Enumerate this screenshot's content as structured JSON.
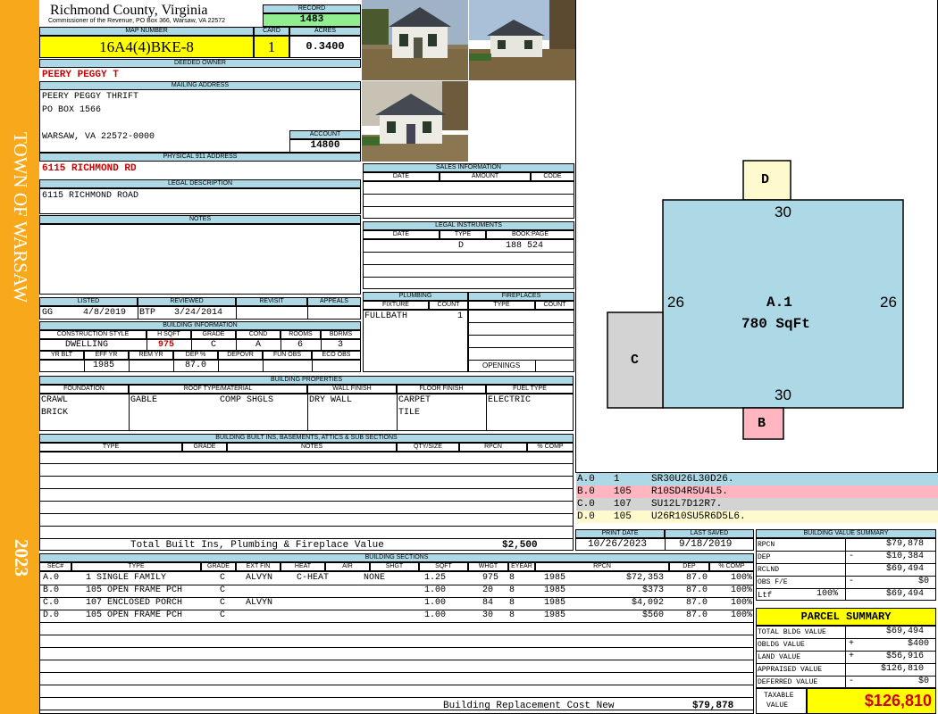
{
  "sidebar": {
    "town": "TOWN OF WARSAW",
    "year": "2023"
  },
  "header": {
    "county": "Richmond County, Virginia",
    "address": "Commissioner of the Revenue, PO Box 366, Warsaw, VA 22572",
    "record_label": "RECORD",
    "record": "1483",
    "map_label": "MAP NUMBER",
    "map_number": "16A4(4)BKE-8",
    "card_label": "CARD",
    "card": "1",
    "acres_label": "ACRES",
    "acres": "0.3400"
  },
  "owner": {
    "deeded_label": "DEEDED OWNER",
    "deeded": "PEERY PEGGY T",
    "mailing_label": "MAILING ADDRESS",
    "mail1": "PEERY PEGGY THRIFT",
    "mail2": "PO BOX 1566",
    "mail3": "WARSAW, VA 22572-0000",
    "account_label": "ACCOUNT",
    "account": "14800",
    "p911_label": "PHYSICAL 911 ADDRESS",
    "p911": "6115 RICHMOND RD",
    "legal_label": "LEGAL DESCRIPTION",
    "legal": "6115 RICHMOND ROAD",
    "notes_label": "NOTES"
  },
  "sales": {
    "title": "SALES INFORMATION",
    "cols": [
      "DATE",
      "AMOUNT",
      "CODE"
    ]
  },
  "legal_instruments": {
    "title": "LEGAL INSTRUMENTS",
    "cols": [
      "DATE",
      "TYPE",
      "BOOK:PAGE"
    ],
    "type": "D",
    "bookpage": "188 524"
  },
  "listing": {
    "cols": [
      "LISTED",
      "REVIEWED",
      "REVISIT",
      "APPEALS"
    ],
    "listed_by": "GG",
    "listed": "4/8/2019",
    "reviewed_by": "BTP",
    "reviewed": "3/24/2014"
  },
  "plumbing": {
    "title": "PLUMBING",
    "cols": [
      "FIXTURE",
      "COUNT"
    ],
    "fixture": "FULLBATH",
    "count": "1"
  },
  "fireplaces": {
    "title": "FIREPLACES",
    "cols": [
      "TYPE",
      "COUNT"
    ],
    "openings": "OPENINGS"
  },
  "building_info": {
    "title": "BUILDING INFORMATION",
    "cols1": [
      "CONSTRUCTION STYLE",
      "H SQFT",
      "GRADE",
      "COND",
      "ROOMS",
      "BDRMS"
    ],
    "style": "DWELLING",
    "hsqft": "975",
    "grade": "C",
    "cond": "A",
    "rooms": "6",
    "bdrms": "3",
    "cols2": [
      "YR BLT",
      "EFF YR",
      "REM YR",
      "DEP %",
      "DEPOVR",
      "FUN OBS",
      "ECO OBS"
    ],
    "eff_yr": "1985",
    "dep": "87.0"
  },
  "properties": {
    "title": "BUILDING PROPERTIES",
    "cols": [
      "FOUNDATION",
      "ROOF TYPE/MATERIAL",
      "WALL FINISH",
      "FLOOR FINISH",
      "FUEL TYPE"
    ],
    "foundation1": "CRAWL",
    "foundation2": "BRICK",
    "roof_type": "GABLE",
    "roof_mat": "COMP SHGLS",
    "wall": "DRY WALL",
    "floor1": "CARPET",
    "floor2": "TILE",
    "fuel": "ELECTRIC"
  },
  "builtins": {
    "title": "BUILDING BUILT INS, BASEMENTS, ATTICS & SUB SECTIONS",
    "cols": [
      "TYPE",
      "GRADE",
      "NOTES",
      "QTY/SIZE",
      "RPCN",
      "% COMP"
    ],
    "total_label": "Total Built Ins, Plumbing & Fireplace Value",
    "total": "$2,500"
  },
  "print": {
    "cols": [
      "PRINT DATE",
      "LAST SAVED"
    ],
    "print_date": "10/26/2023",
    "last_saved": "9/18/2019"
  },
  "sections": {
    "title": "BUILDING SECTIONS",
    "cols": [
      "SEC#",
      "TYPE",
      "GRADE",
      "EXT FIN",
      "HEAT",
      "AIR",
      "SHGT",
      "SQFT",
      "WHGT",
      "EYEAR",
      "RPCN",
      "DEP",
      "% COMP"
    ],
    "rows": [
      [
        "A.0",
        "1 SINGLE FAMILY",
        "C",
        "ALVYN",
        "C-HEAT",
        "NONE",
        "1.25",
        "975",
        "8",
        "1985",
        "$72,353",
        "87.0",
        "100%"
      ],
      [
        "B.0",
        "105 OPEN FRAME PCH",
        "C",
        "",
        "",
        "",
        "1.00",
        "20",
        "8",
        "1985",
        "$373",
        "87.0",
        "100%"
      ],
      [
        "C.0",
        "107 ENCLOSED PORCH",
        "C",
        "ALVYN",
        "",
        "",
        "1.00",
        "84",
        "8",
        "1985",
        "$4,092",
        "87.0",
        "100%"
      ],
      [
        "D.0",
        "105 OPEN FRAME PCH",
        "C",
        "",
        "",
        "",
        "1.00",
        "30",
        "8",
        "1985",
        "$560",
        "87.0",
        "100%"
      ]
    ],
    "brcn_label": "Building Replacement Cost New",
    "brcn": "$79,878"
  },
  "sketch": {
    "main_label": "A.1",
    "main_area": "780 SqFt",
    "dim_top": "30",
    "dim_bottom": "30",
    "dim_left": "26",
    "dim_right": "26",
    "d_label": "D",
    "c_label": "C",
    "b_label": "B"
  },
  "legend": [
    {
      "sec": "A.0",
      "code": "1",
      "path": "SR30U26L30D26.",
      "color": "#add8e6"
    },
    {
      "sec": "B.0",
      "code": "105",
      "path": "R10SD4R5U4L5.",
      "color": "#ffb6c1"
    },
    {
      "sec": "C.0",
      "code": "107",
      "path": "SU12L7D12R7.",
      "color": "#d3d3d3"
    },
    {
      "sec": "D.0",
      "code": "105",
      "path": "U26R10SU5R6D5L6.",
      "color": "#fffacd"
    }
  ],
  "value_summary": {
    "title": "BUILDING VALUE SUMMARY",
    "rpcn_label": "RPCN",
    "rpcn": "$79,878",
    "dep_label": "DEP",
    "dep_sign": "-",
    "dep": "$10,384",
    "rclnd_label": "RCLND",
    "rclnd": "$69,494",
    "obs_label": "OBS F/E",
    "obs_sign": "-",
    "obs": "$0",
    "ltf_label": "Ltf",
    "ltf_pct": "100%",
    "ltf": "$69,494"
  },
  "parcel": {
    "title": "PARCEL SUMMARY",
    "bldg_label": "TOTAL BLDG VALUE",
    "bldg": "$69,494",
    "obldg_label": "OBLDG VALUE",
    "obldg_sign": "+",
    "obldg": "$400",
    "land_label": "LAND VALUE",
    "land_sign": "+",
    "land": "$56,916",
    "appraised_label": "APPRAISED VALUE",
    "appraised": "$126,810",
    "deferred_label": "DEFERRED VALUE",
    "deferred_sign": "-",
    "deferred": "$0",
    "taxable_label1": "TAXABLE",
    "taxable_label2": "VALUE",
    "taxable": "$126,810"
  }
}
